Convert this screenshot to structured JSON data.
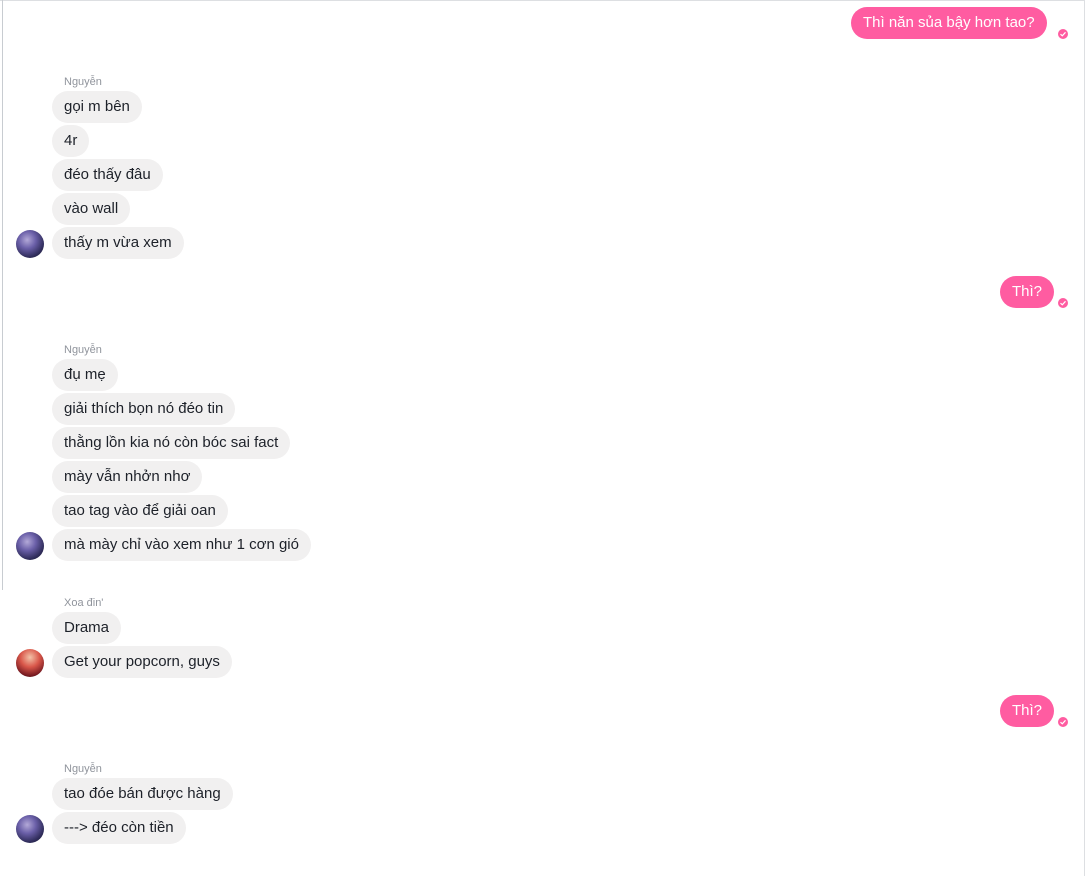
{
  "thread": {
    "outgoing": [
      {
        "text": "Thì năn sủa bậy hơn tao?"
      },
      {
        "text": "Thì?"
      },
      {
        "text": "Thì?"
      }
    ],
    "groups": [
      {
        "sender": "Nguyễn",
        "avatar": "user-avatar-icon",
        "messages": [
          "gọi m bên",
          "4r",
          "đéo thấy đâu",
          "vào wall",
          "thấy m vừa xem"
        ]
      },
      {
        "sender": "Nguyễn",
        "avatar": "user-avatar-icon",
        "messages": [
          "đụ mẹ",
          "giải thích bọn nó đéo tin",
          "thằng lồn kia nó còn bóc sai fact",
          "mày vẫn nhởn nhơ",
          "tao tag vào để giải oan",
          "mà mày chỉ vào xem như 1 cơn gió"
        ]
      },
      {
        "sender": "Xoa đin'",
        "avatar": "user-avatar-icon",
        "messages": [
          "Drama",
          "Get your popcorn, guys"
        ]
      },
      {
        "sender": "Nguyễn",
        "avatar": "user-avatar-icon",
        "messages": [
          "tao đóe bán được hàng",
          "---> đéo còn tiền"
        ]
      }
    ],
    "seen_icon": "check-circle-icon"
  },
  "colors": {
    "outgoing_bubble": "#ff5ca1",
    "incoming_bubble": "#f1f0f0",
    "sender_name": "#90949c"
  }
}
